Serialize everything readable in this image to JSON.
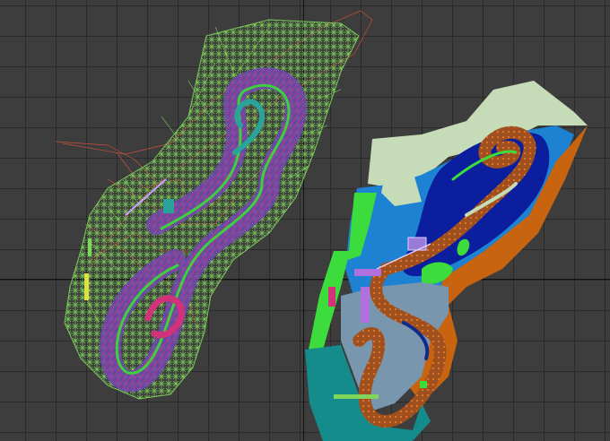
{
  "viewport": {
    "name": "perspective-viewport",
    "background": "#3d3d3d",
    "grid_color": "#2a2a2a",
    "axis_color": "#111111"
  },
  "wireframe_model": {
    "name": "track-wireframe-mesh",
    "colors": {
      "vegetation": "#7fd65a",
      "terrain_edges": "#c8503c",
      "track_magenta": "#d2327a",
      "track_green": "#3cd23c",
      "track_purple": "#6e46b4",
      "track_teal": "#2aa39a"
    }
  },
  "textured_model": {
    "name": "track-textured-model",
    "colors": {
      "sand": "#c6dcb8",
      "water": "#1e82d2",
      "deep_water": "#0a1e9e",
      "dirt": "#c8640f",
      "grass": "#3cdc3c",
      "slate": "#7896ae",
      "teal_ground": "#148c8c",
      "track_brown": "#a0501e",
      "dark_blue": "#102a8c"
    }
  }
}
